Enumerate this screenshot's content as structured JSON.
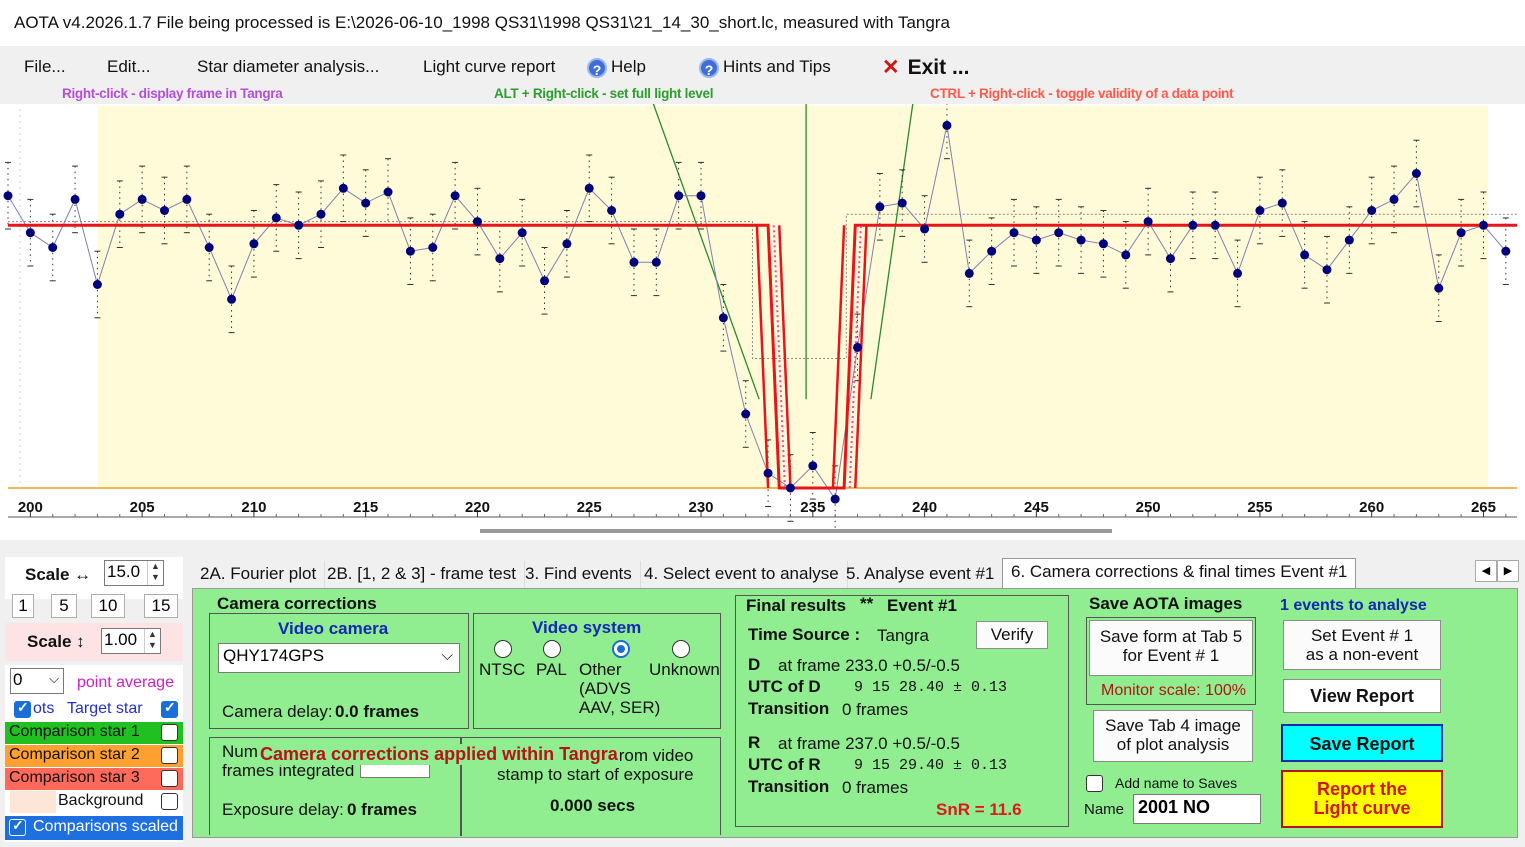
{
  "window": {
    "title": "AOTA v4.2026.1.7     File being processed is E:\\2026-06-10_1998 QS31\\1998 QS31\\21_14_30_short.lc, measured with Tangra"
  },
  "menu": {
    "file": "File...",
    "edit": "Edit...",
    "star_diameter": "Star diameter analysis...",
    "light_curve_report": "Light curve report",
    "help": "Help",
    "hints_tips": "Hints and Tips",
    "exit": "Exit ..."
  },
  "hints": {
    "right_click": "Right-click  -  display frame in Tangra",
    "alt_right_click": "ALT + Right-click  -  set full light level",
    "ctrl_right_click": "CTRL + Right-click  -  toggle validity of a data point"
  },
  "colors": {
    "hint_purple": "#b44fd8",
    "hint_green": "#2e9e2e",
    "hint_red": "#ff5a4a",
    "plot_bg": "#fffbd9",
    "model_red": "#e8141a",
    "data_blue": "#00007a",
    "panel_green": "#90ee90"
  },
  "chart_data": {
    "type": "scatter",
    "x_ticks": [
      200,
      205,
      210,
      215,
      220,
      225,
      230,
      235,
      240,
      245,
      250,
      255,
      260,
      265
    ],
    "xlim": [
      199,
      266.5
    ],
    "ylim": [
      0,
      1.0
    ],
    "grid": false,
    "x": [
      199,
      200,
      201,
      202,
      203,
      204,
      205,
      206,
      207,
      208,
      209,
      210,
      211,
      212,
      213,
      214,
      215,
      216,
      217,
      218,
      219,
      220,
      221,
      222,
      223,
      224,
      225,
      226,
      227,
      228,
      229,
      230,
      231,
      232,
      233,
      234,
      235,
      236,
      237,
      238,
      239,
      240,
      241,
      242,
      243,
      244,
      245,
      246,
      247,
      248,
      249,
      250,
      251,
      252,
      253,
      254,
      255,
      256,
      257,
      258,
      259,
      260,
      261,
      262,
      263,
      264,
      265,
      266
    ],
    "y": [
      0.79,
      0.69,
      0.65,
      0.78,
      0.55,
      0.74,
      0.78,
      0.75,
      0.78,
      0.65,
      0.51,
      0.66,
      0.73,
      0.71,
      0.74,
      0.81,
      0.77,
      0.8,
      0.64,
      0.65,
      0.79,
      0.72,
      0.62,
      0.69,
      0.56,
      0.66,
      0.81,
      0.75,
      0.61,
      0.61,
      0.79,
      0.79,
      0.46,
      0.2,
      0.04,
      0.0,
      0.06,
      -0.03,
      0.38,
      0.76,
      0.77,
      0.7,
      0.98,
      0.58,
      0.64,
      0.69,
      0.67,
      0.69,
      0.67,
      0.66,
      0.63,
      0.72,
      0.62,
      0.71,
      0.71,
      0.58,
      0.75,
      0.77,
      0.63,
      0.59,
      0.67,
      0.75,
      0.78,
      0.85,
      0.54,
      0.69,
      0.71,
      0.64
    ],
    "series": [
      {
        "name": "Target star",
        "values": []
      }
    ],
    "model_baseline": 0.71,
    "model_event_level": 0.0,
    "d_frame": 233.0,
    "r_frame": 237.0
  },
  "left": {
    "scale_h_label": "Scale ↔",
    "scale_h_value": "15.0",
    "scale_buttons": [
      "1",
      "5",
      "10",
      "15"
    ],
    "scale_v_label": "Scale ↕",
    "scale_v_value": "1.00",
    "point_avg_value": "0",
    "point_avg_label": "point average",
    "dots_label": "ots",
    "target_star": "Target star",
    "comp1": "Comparison star 1",
    "comp2": "Comparison star 2",
    "comp3": "Comparison star 3",
    "background": "Background",
    "comparisons_scaled": "Comparisons scaled"
  },
  "tabs": [
    "2A. Fourier plot",
    "2B. [1, 2 & 3] - frame test",
    "3. Find events",
    "4. Select event to analyse",
    "5. Analyse event #1",
    "6. Camera corrections & final times Event #1"
  ],
  "camera": {
    "group_title": "Camera corrections",
    "video_camera_title": "Video camera",
    "camera_selected": "QHY174GPS",
    "camera_delay": "Camera delay:",
    "camera_delay_value": "0.0 frames",
    "video_system_title": "Video system",
    "ntsc": "NTSC",
    "pal": "PAL",
    "other": "Other",
    "other_sub1": "(ADVS",
    "other_sub2": "AAV, SER)",
    "unknown": "Unknown",
    "num_frames": "Num",
    "frames_integrated": "frames integrated",
    "overlay_msg": "Camera corrections applied within Tangra",
    "from_video": "from video",
    "stamp_to_start": "stamp to start of exposure",
    "exposure_delay": "Exposure delay:",
    "exposure_delay_value": "0 frames",
    "secs": "0.000 secs"
  },
  "final": {
    "title": "Final results",
    "stars": "**",
    "event": "Event #1",
    "time_source_label": "Time Source :",
    "time_source": "Tangra",
    "verify": "Verify",
    "d_label": "D",
    "d_frame": "at frame 233.0  +0.5/-0.5",
    "utc_d_label": "UTC of D",
    "utc_d": "9 15 28.40   ± 0.13",
    "transition_label": "Transition",
    "transition_d": "0 frames",
    "r_label": "R",
    "r_frame": "at frame 237.0  +0.5/-0.5",
    "utc_r_label": "UTC of R",
    "utc_r": "9 15 29.40   ± 0.13",
    "transition_r": "0 frames",
    "snr": "SnR = 11.6"
  },
  "save": {
    "title": "Save AOTA images",
    "save_form_l1": "Save form at Tab 5",
    "save_form_l2": "for Event # 1",
    "monitor_scale": "Monitor scale: 100%",
    "save_tab4_l1": "Save Tab 4 image",
    "save_tab4_l2": "of plot analysis",
    "add_name": "Add name to Saves",
    "name_label": "Name",
    "name_value": "2001 NO"
  },
  "events": {
    "count_label": "1  events to analyse",
    "set_event_l1": "Set Event # 1",
    "set_event_l2": "as a non-event",
    "view_report": "View Report",
    "save_report": "Save Report",
    "report_l1": "Report the",
    "report_l2": "Light curve"
  }
}
